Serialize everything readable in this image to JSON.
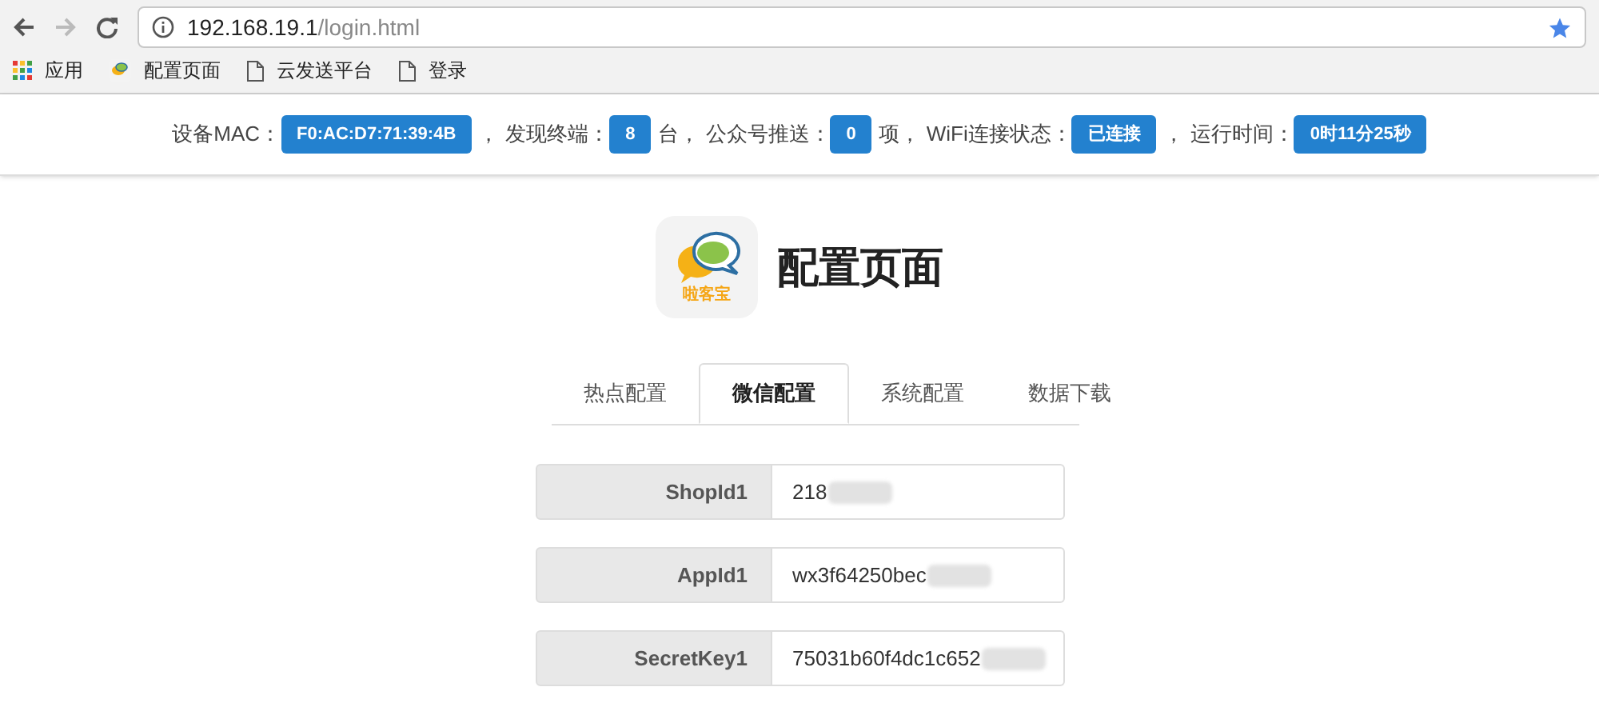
{
  "browser": {
    "url_host": "192.168.19.1",
    "url_path": "/login.html",
    "bookmarks": [
      {
        "kind": "apps",
        "label": "应用"
      },
      {
        "kind": "site",
        "label": "配置页面"
      },
      {
        "kind": "page",
        "label": "云发送平台"
      },
      {
        "kind": "page",
        "label": "登录"
      }
    ]
  },
  "status": [
    {
      "label": "设备MAC：",
      "value": "F0:AC:D7:71:39:4B",
      "suffix": "，"
    },
    {
      "label": "发现终端：",
      "value": "8",
      "suffix": "台，"
    },
    {
      "label": "公众号推送：",
      "value": "0",
      "suffix": "项，"
    },
    {
      "label": "WiFi连接状态：",
      "value": "已连接",
      "suffix": "，"
    },
    {
      "label": "运行时间：",
      "value": "0时11分25秒"
    }
  ],
  "header": {
    "logo_text": "啦客宝",
    "title": "配置页面"
  },
  "tabs": [
    {
      "label": "热点配置",
      "selected": false
    },
    {
      "label": "微信配置",
      "selected": true
    },
    {
      "label": "系统配置",
      "selected": false
    },
    {
      "label": "数据下载",
      "selected": false
    }
  ],
  "fields": [
    {
      "label": "ShopId1",
      "value": "218"
    },
    {
      "label": "AppId1",
      "value": "wx3f64250bec"
    },
    {
      "label": "SecretKey1",
      "value": "75031b60f4dc1c652"
    }
  ]
}
